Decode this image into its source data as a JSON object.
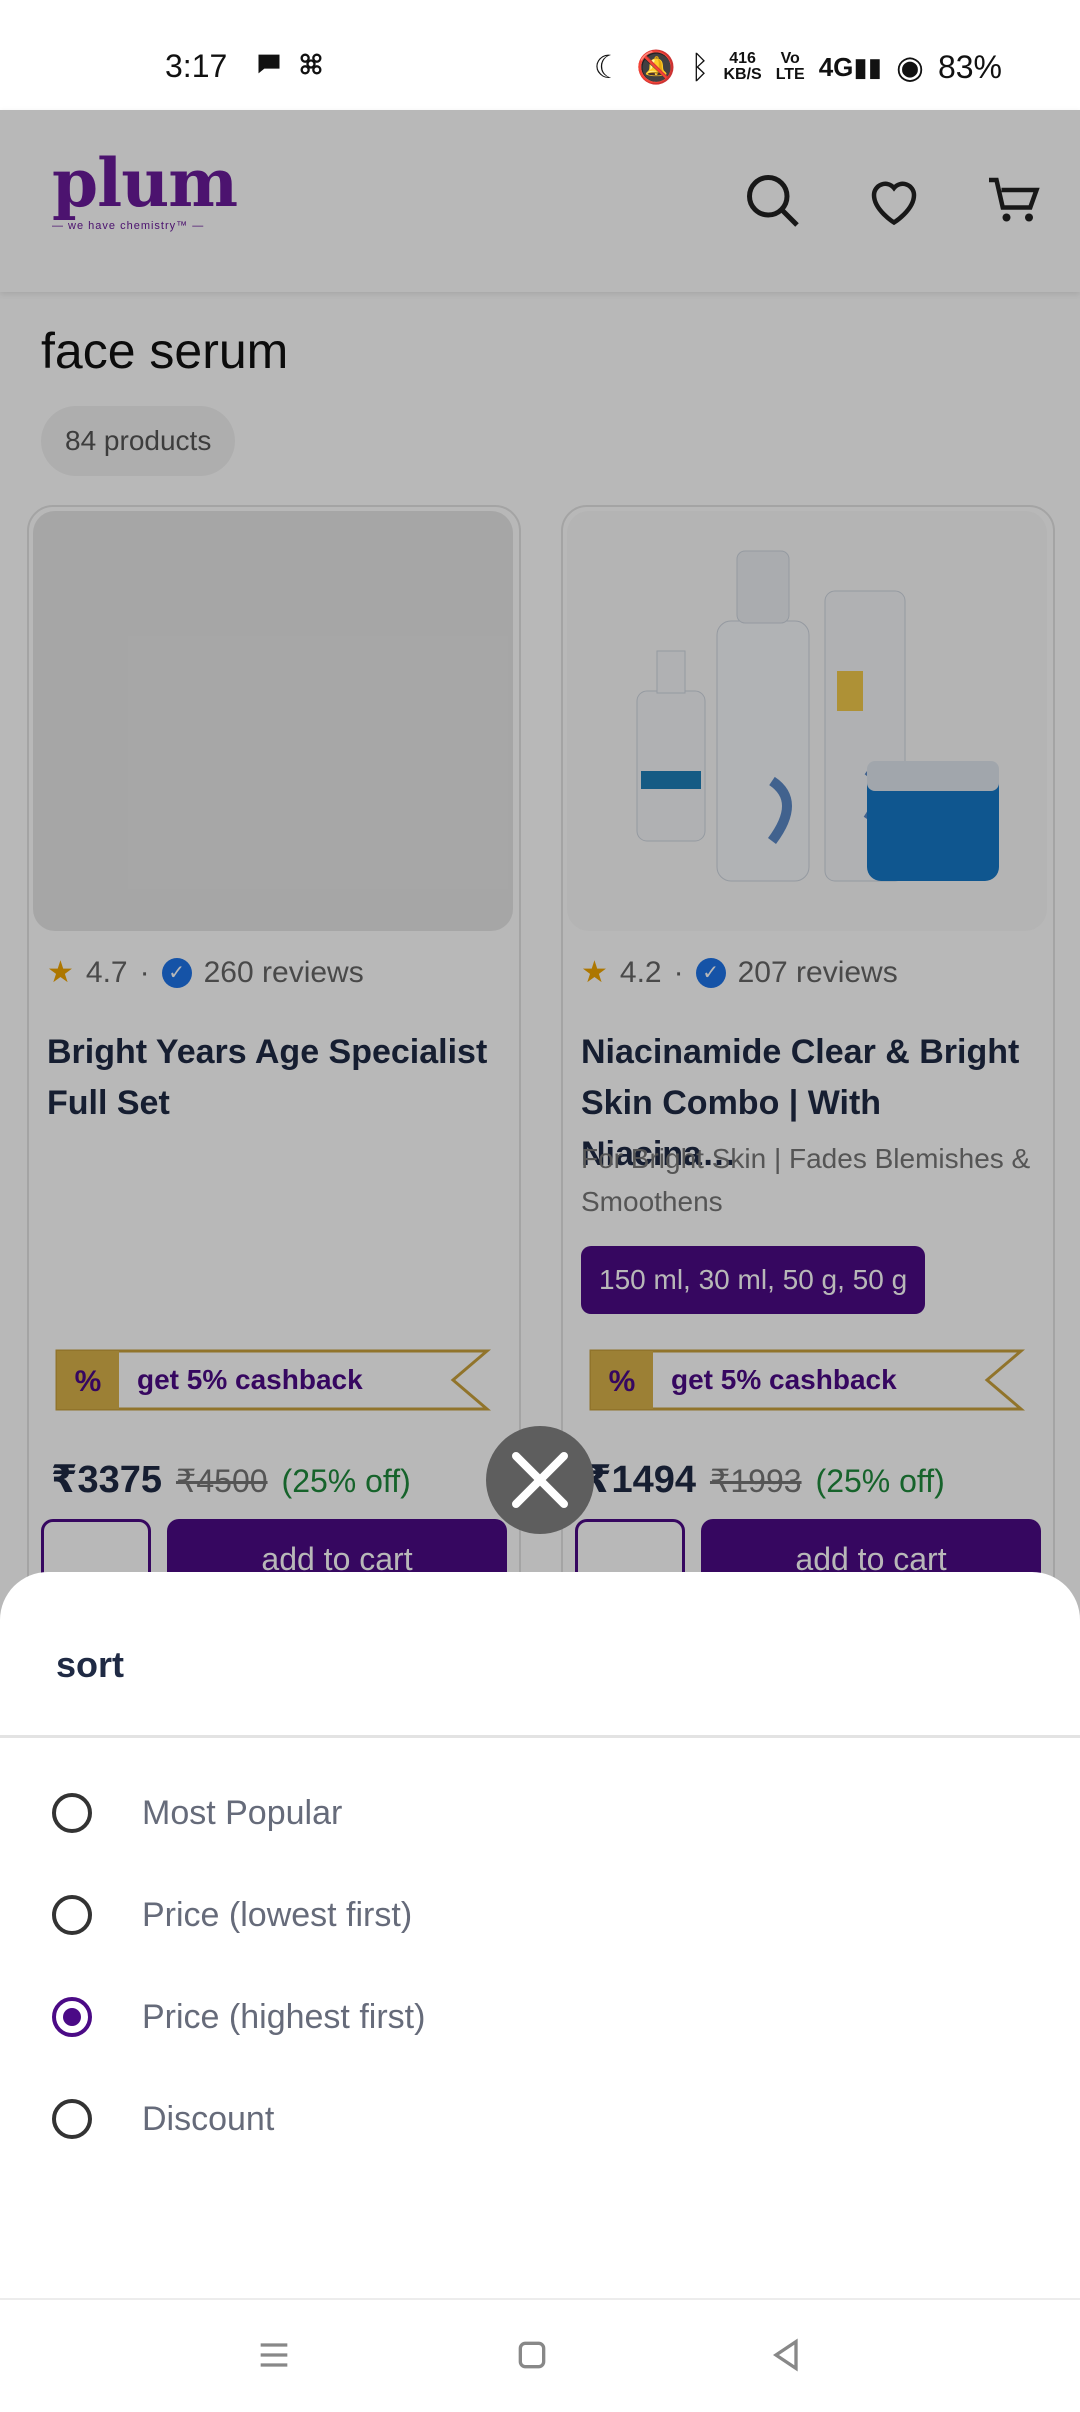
{
  "status_bar": {
    "time": "3:17",
    "net_speed_top": "416",
    "net_speed_bottom": "KB/S",
    "battery": "83%",
    "network": "4G"
  },
  "header": {
    "logo_text": "plum",
    "logo_tagline": "— we have chemistry™ —",
    "icons": [
      "search-icon",
      "heart-icon",
      "cart-icon"
    ]
  },
  "results": {
    "query": "face serum",
    "count_label": "84 products"
  },
  "products": [
    {
      "rating": "4.7",
      "reviews": "260 reviews",
      "name": "Bright Years Age Specialist Full Set",
      "subtitle": "",
      "variant": "",
      "cashback": "get 5% cashback",
      "price": "₹3375",
      "mrp": "₹4500",
      "discount": "(25% off)",
      "cart_label": "add to cart"
    },
    {
      "rating": "4.2",
      "reviews": "207 reviews",
      "name": "Niacinamide Clear & Bright Skin Combo | With Niacina…",
      "subtitle": "For Bright Skin | Fades Blemishes & Smoothens",
      "variant": "150 ml, 30 ml, 50 g, 50 g",
      "cashback": "get 5% cashback",
      "price": "₹1494",
      "mrp": "₹1993",
      "discount": "(25% off)",
      "cart_label": "add to cart"
    }
  ],
  "sort_sheet": {
    "title": "sort",
    "options": [
      {
        "label": "Most Popular",
        "selected": false
      },
      {
        "label": "Price (lowest first)",
        "selected": false
      },
      {
        "label": "Price (highest first)",
        "selected": true
      },
      {
        "label": "Discount",
        "selected": false
      }
    ]
  },
  "colors": {
    "brand": "#4b0a86",
    "discount_green": "#1f8a3c",
    "star": "#f0a500"
  }
}
